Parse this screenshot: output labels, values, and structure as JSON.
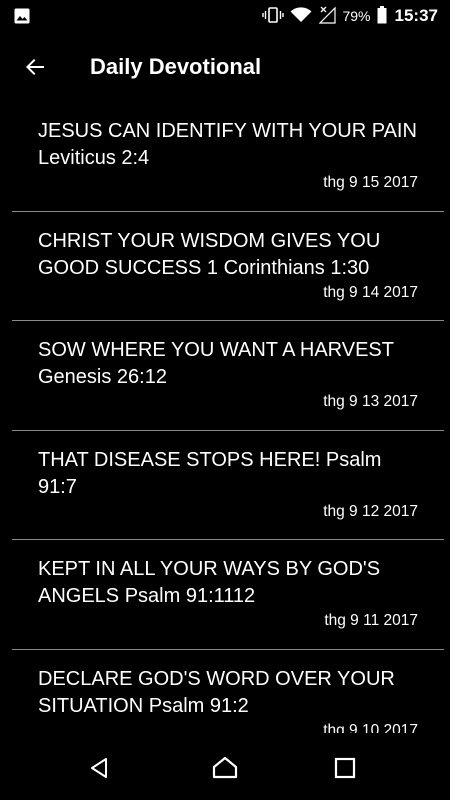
{
  "status_bar": {
    "battery_percent": "79%",
    "time": "15:37",
    "icons": [
      "image-icon",
      "vibrate-icon",
      "wifi-icon",
      "no-signal-icon",
      "battery-icon"
    ]
  },
  "app_bar": {
    "title": "Daily Devotional"
  },
  "devotionals": [
    {
      "title": "JESUS CAN IDENTIFY WITH YOUR PAIN Leviticus 2:4",
      "date": "thg 9 15 2017"
    },
    {
      "title": "CHRIST YOUR WISDOM GIVES YOU GOOD SUCCESS 1 Corinthians 1:30",
      "date": "thg 9 14 2017"
    },
    {
      "title": "SOW WHERE YOU WANT A HARVEST Genesis 26:12",
      "date": "thg 9 13 2017"
    },
    {
      "title": "THAT DISEASE STOPS HERE! Psalm 91:7",
      "date": "thg 9 12 2017"
    },
    {
      "title": "KEPT IN ALL YOUR WAYS BY GOD'S ANGELS Psalm 91:1112",
      "date": "thg 9 11 2017"
    },
    {
      "title": "DECLARE GOD'S WORD OVER YOUR SITUATION Psalm 91:2",
      "date": "thg 9 10 2017"
    }
  ],
  "nav_bar": {
    "icons": [
      "back-triangle-icon",
      "home-icon",
      "recents-icon"
    ]
  },
  "colors": {
    "background": "#000000",
    "text": "#ffffff",
    "divider": "#8a8a8a"
  }
}
